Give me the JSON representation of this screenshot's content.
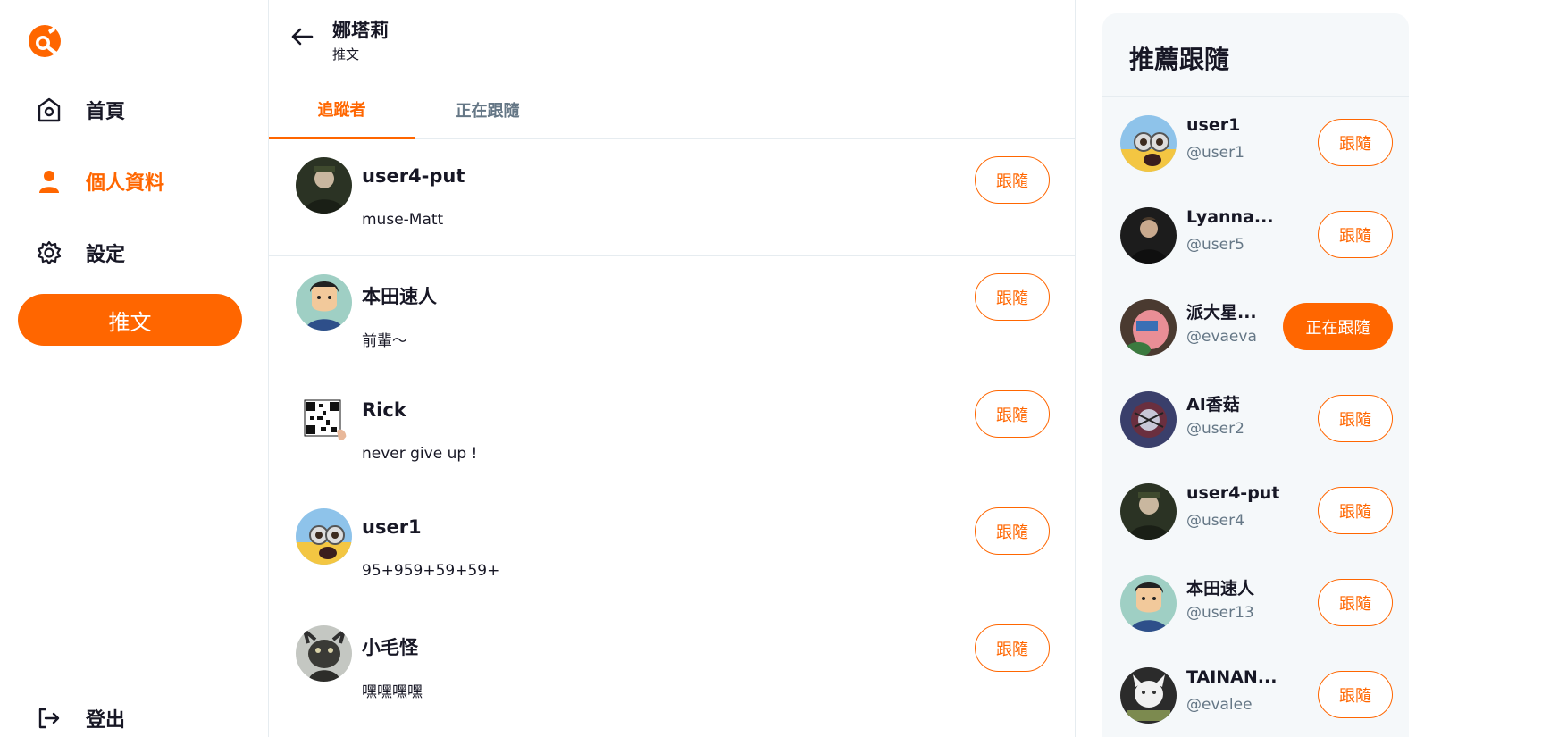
{
  "sidebar": {
    "items": [
      {
        "label": "首頁",
        "icon": "home-icon"
      },
      {
        "label": "個人資料",
        "icon": "user-icon",
        "active": true
      },
      {
        "label": "設定",
        "icon": "gear-icon"
      }
    ],
    "tweet_button": "推文",
    "logout_label": "登出"
  },
  "header": {
    "name": "娜塔莉",
    "subtitle": "推文"
  },
  "tabs": [
    {
      "label": "追蹤者",
      "active": true
    },
    {
      "label": "正在跟隨",
      "active": false
    }
  ],
  "followers": [
    {
      "name": "user4-put",
      "bio": "muse-Matt",
      "button": "跟隨"
    },
    {
      "name": "本田速人",
      "bio": "前輩～",
      "button": "跟隨"
    },
    {
      "name": "Rick",
      "bio": "never give up !",
      "button": "跟隨"
    },
    {
      "name": "user1",
      "bio": "95+959+59+59+",
      "button": "跟隨"
    },
    {
      "name": "小毛怪",
      "bio": "嘿嘿嘿嘿",
      "button": "跟隨"
    }
  ],
  "suggestions": {
    "title": "推薦跟隨",
    "users": [
      {
        "name": "user1",
        "handle": "@user1",
        "button": "跟隨",
        "following": false
      },
      {
        "name": "Lyanna...",
        "handle": "@user5",
        "button": "跟隨",
        "following": false
      },
      {
        "name": "派大星...",
        "handle": "@evaeva",
        "button": "正在跟隨",
        "following": true
      },
      {
        "name": "AI香菇",
        "handle": "@user2",
        "button": "跟隨",
        "following": false
      },
      {
        "name": "user4-put",
        "handle": "@user4",
        "button": "跟隨",
        "following": false
      },
      {
        "name": "本田速人",
        "handle": "@user13",
        "button": "跟隨",
        "following": false
      },
      {
        "name": "TAINAN...",
        "handle": "@evalee",
        "button": "跟隨",
        "following": false
      }
    ]
  },
  "colors": {
    "accent": "#ff6600",
    "border": "#e6ecf0",
    "muted": "#657786"
  }
}
